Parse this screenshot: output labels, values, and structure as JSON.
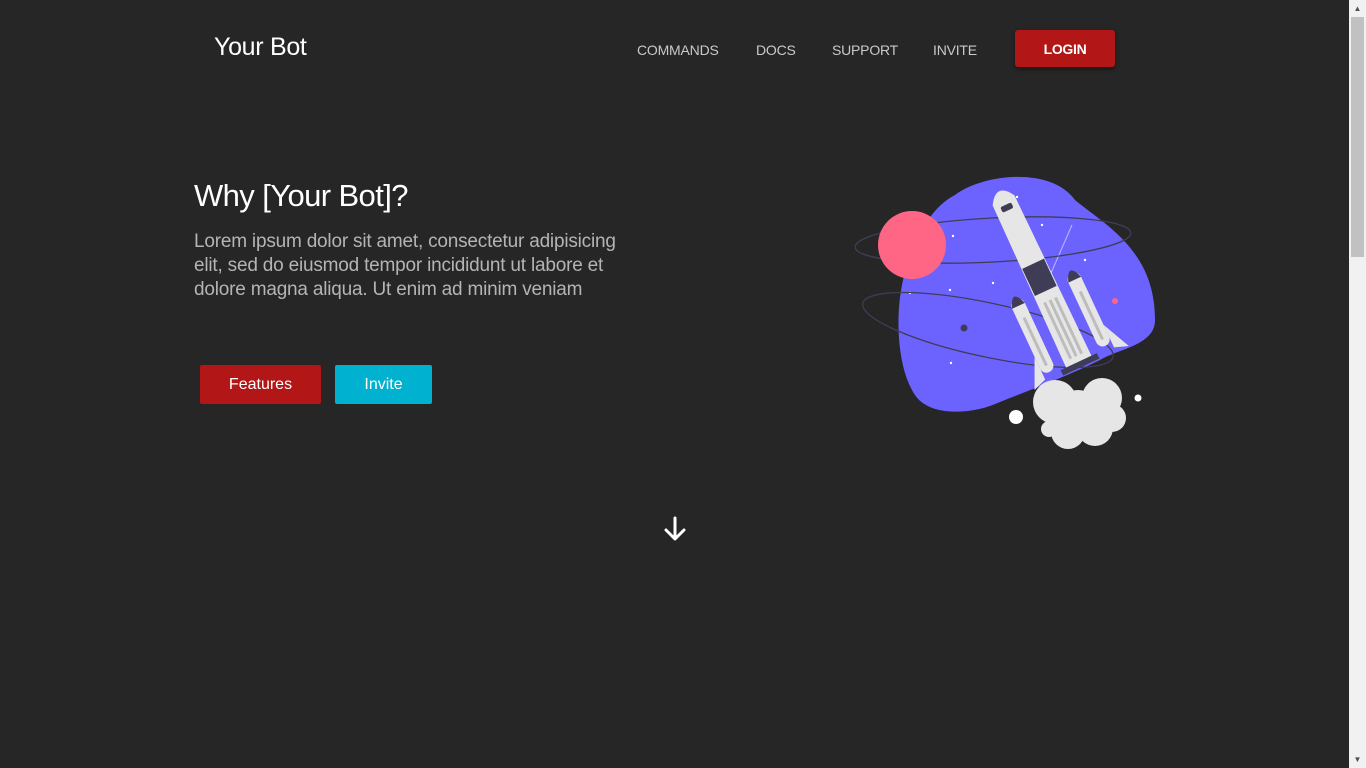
{
  "header": {
    "brand": "Your Bot",
    "nav": [
      {
        "label": "COMMANDS"
      },
      {
        "label": "DOCS"
      },
      {
        "label": "SUPPORT"
      },
      {
        "label": "INVITE"
      }
    ],
    "login_label": "LOGIN"
  },
  "hero": {
    "title": "Why [Your Bot]?",
    "description": "Lorem ipsum dolor sit amet, consectetur adipisicing elit, sed do eiusmod tempor incididunt ut labore et dolore magna aliqua. Ut enim ad minim veniam",
    "features_label": "Features",
    "invite_label": "Invite"
  },
  "icons": {
    "illustration": "rocket-launch-illustration",
    "scroll": "arrow-down-icon"
  },
  "colors": {
    "background": "#262626",
    "primary": "#b21616",
    "secondary": "#00b2cf",
    "illustration_blob": "#6c63ff",
    "planet": "#ff6584"
  }
}
